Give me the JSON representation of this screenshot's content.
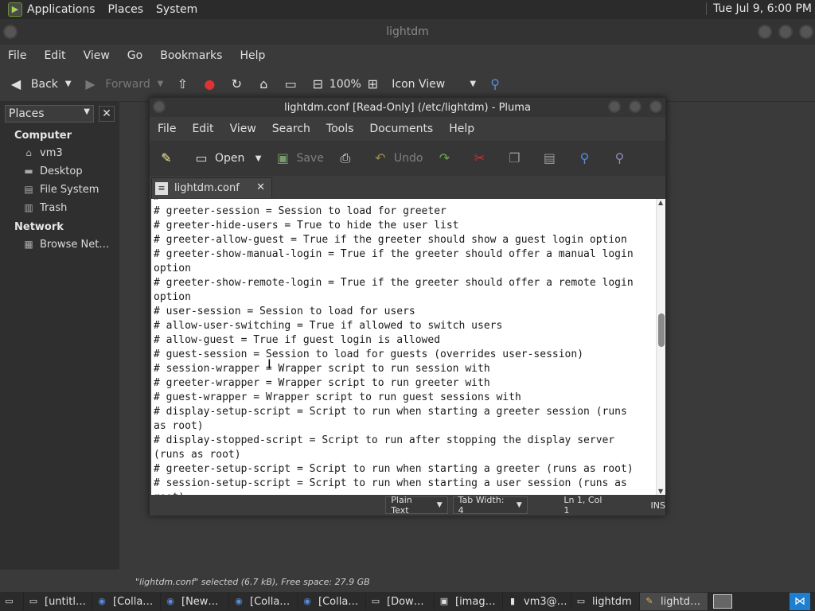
{
  "top_panel": {
    "menus": [
      "Applications",
      "Places",
      "System"
    ],
    "clock": "Tue Jul 9, 6:00 PM"
  },
  "file_manager": {
    "title": "lightdm",
    "menus": [
      "File",
      "Edit",
      "View",
      "Go",
      "Bookmarks",
      "Help"
    ],
    "toolbar": {
      "back": "Back",
      "forward": "Forward",
      "zoom": "100%",
      "view_mode": "Icon View"
    },
    "sidebar": {
      "selector": "Places",
      "sections": [
        {
          "label": "Computer",
          "items": [
            "vm3",
            "Desktop",
            "File System",
            "Trash"
          ]
        },
        {
          "label": "Network",
          "items": [
            "Browse Net…"
          ]
        }
      ]
    },
    "status": "\"lightdm.conf\" selected (6.7 kB), Free space: 27.9 GB"
  },
  "pluma": {
    "title": "lightdm.conf [Read-Only] (/etc/lightdm) - Pluma",
    "menus": [
      "File",
      "Edit",
      "View",
      "Search",
      "Tools",
      "Documents",
      "Help"
    ],
    "toolbar": {
      "open": "Open",
      "save": "Save",
      "undo": "Undo"
    },
    "tab_label": "lightdm.conf",
    "lines": [
      "#",
      "# greeter-session = Session to load for greeter",
      "# greeter-hide-users = True to hide the user list",
      "# greeter-allow-guest = True if the greeter should show a guest login option",
      "# greeter-show-manual-login = True if the greeter should offer a manual login",
      "option",
      "# greeter-show-remote-login = True if the greeter should offer a remote login",
      "option",
      "# user-session = Session to load for users",
      "# allow-user-switching = True if allowed to switch users",
      "# allow-guest = True if guest login is allowed",
      "# guest-session = Session to load for guests (overrides user-session)",
      "# session-wrapper = Wrapper script to run session with",
      "# greeter-wrapper = Wrapper script to run greeter with",
      "# guest-wrapper = Wrapper script to run guest sessions with",
      "# display-setup-script = Script to run when starting a greeter session (runs",
      "as root)",
      "# display-stopped-script = Script to run after stopping the display server",
      "(runs as root)",
      "# greeter-setup-script = Script to run when starting a greeter (runs as root)",
      "# session-setup-script = Script to run when starting a user session (runs as",
      "root)"
    ],
    "status": {
      "language": "Plain Text",
      "tab_width": "Tab Width:  4",
      "position": "Ln 1, Col 1",
      "mode": "INS"
    }
  },
  "taskbar": {
    "tasks": [
      "[untitl…",
      "[Colla…",
      "[New…",
      "[Colla…",
      "[Colla…",
      "[Dow…",
      "[imag…",
      "vm3@…",
      "lightdm",
      "lightd…"
    ]
  }
}
